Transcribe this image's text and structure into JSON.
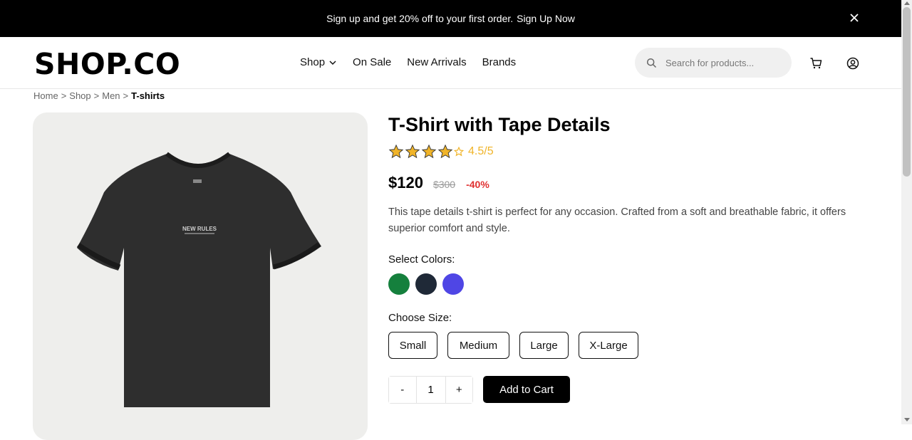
{
  "promo": {
    "text": "Sign up and get 20% off to your first order.",
    "link": "Sign Up Now",
    "close_icon": "close-icon"
  },
  "header": {
    "logo": "SHOP.CO",
    "nav": [
      {
        "label": "Shop",
        "icon": "chevron-down-icon"
      },
      {
        "label": "On Sale"
      },
      {
        "label": "New Arrivals"
      },
      {
        "label": "Brands"
      }
    ],
    "search_placeholder": "Search for products...",
    "icons": [
      "search-icon",
      "cart-icon",
      "user-icon"
    ]
  },
  "breadcrumb": {
    "items": [
      "Home",
      "Shop",
      "Men"
    ],
    "separator": ">",
    "current": "T-shirts"
  },
  "product": {
    "title": "T-Shirt with Tape Details",
    "rating_value": 4.5,
    "rating_max": 5,
    "rating_text": "4.5/5",
    "price": "$120",
    "old_price": "$300",
    "discount": "-40%",
    "description": "This tape details t-shirt is perfect for any occasion. Crafted from a soft and breathable fabric, it offers superior comfort and style.",
    "image_print_text": "NEW RULES",
    "colors_label": "Select Colors:",
    "colors": [
      {
        "name": "green",
        "hex": "#15803d"
      },
      {
        "name": "dark-navy",
        "hex": "#1f2937"
      },
      {
        "name": "indigo",
        "hex": "#4f46e5"
      }
    ],
    "size_label": "Choose Size:",
    "sizes": [
      "Small",
      "Medium",
      "Large",
      "X-Large"
    ],
    "quantity": {
      "minus": "-",
      "value": "1",
      "plus": "+"
    },
    "add_to_cart": "Add to Cart"
  },
  "colors": {
    "topbar_bg": "#000000",
    "star": "#f0b429",
    "discount": "#e03131",
    "image_bg": "#eeeeec",
    "shirt": "#2e2e2e"
  }
}
